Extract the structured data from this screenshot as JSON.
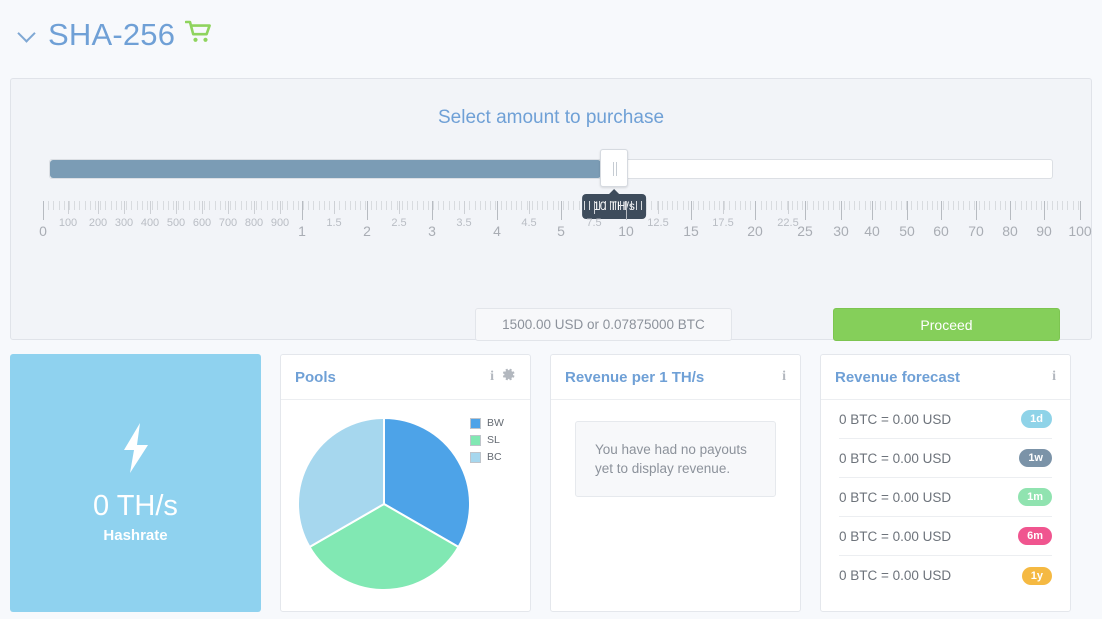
{
  "header": {
    "chevron_icon": "chevron-down-icon",
    "title": "SHA-256",
    "cart_icon": "shopping-cart-icon",
    "title_color": "#6fa0d6",
    "cart_color": "#8fd45e"
  },
  "purchase": {
    "title": "Select amount to purchase",
    "slider": {
      "value_label": "10 TH/s",
      "value": 10,
      "min": 0,
      "max": 100,
      "fill_color": "#7b9cb5",
      "tooltip_bg": "#3e4c5c"
    },
    "ruler": {
      "small_labels": [
        "100",
        "200",
        "300",
        "400",
        "500",
        "600",
        "700",
        "800",
        "900"
      ],
      "mid_labels": [
        "1.5",
        "2.5",
        "3.5",
        "4.5",
        "7.5",
        "12.5",
        "17.5",
        "22.5"
      ],
      "big_labels": [
        "0",
        "1",
        "2",
        "3",
        "4",
        "5",
        "10",
        "15",
        "20",
        "25",
        "30",
        "40",
        "50",
        "60",
        "70",
        "80",
        "90",
        "100"
      ]
    },
    "price_label": "1500.00 USD or 0.07875000 BTC",
    "proceed_label": "Proceed",
    "proceed_color": "#85cf5a"
  },
  "hashrate_card": {
    "icon": "lightning-bolt-icon",
    "value": "0 TH/s",
    "label": "Hashrate",
    "bg_color": "#8fd2ef"
  },
  "pools_card": {
    "title": "Pools",
    "info_icon": "info-icon",
    "gear_icon": "gear-icon"
  },
  "revenue_card": {
    "title": "Revenue per 1 TH/s",
    "info_icon": "info-icon",
    "empty_message": "You have had no payouts yet to display revenue."
  },
  "forecast_card": {
    "title": "Revenue forecast",
    "info_icon": "info-icon",
    "rows": [
      {
        "text": "0 BTC = 0.00 USD",
        "badge": "1d",
        "color": "#8fd3e8"
      },
      {
        "text": "0 BTC = 0.00 USD",
        "badge": "1w",
        "color": "#7b93a8"
      },
      {
        "text": "0 BTC = 0.00 USD",
        "badge": "1m",
        "color": "#90e3b0"
      },
      {
        "text": "0 BTC = 0.00 USD",
        "badge": "6m",
        "color": "#f0558f"
      },
      {
        "text": "0 BTC = 0.00 USD",
        "badge": "1y",
        "color": "#f5b942"
      }
    ]
  },
  "chart_data": {
    "type": "pie",
    "title": "Pools",
    "categories": [
      "BW",
      "SL",
      "BC"
    ],
    "values": [
      33.33,
      33.33,
      33.34
    ],
    "colors": [
      "#4da3e8",
      "#81e8b3",
      "#a6d7ee"
    ],
    "legend_position": "right",
    "labels_shown": false
  }
}
